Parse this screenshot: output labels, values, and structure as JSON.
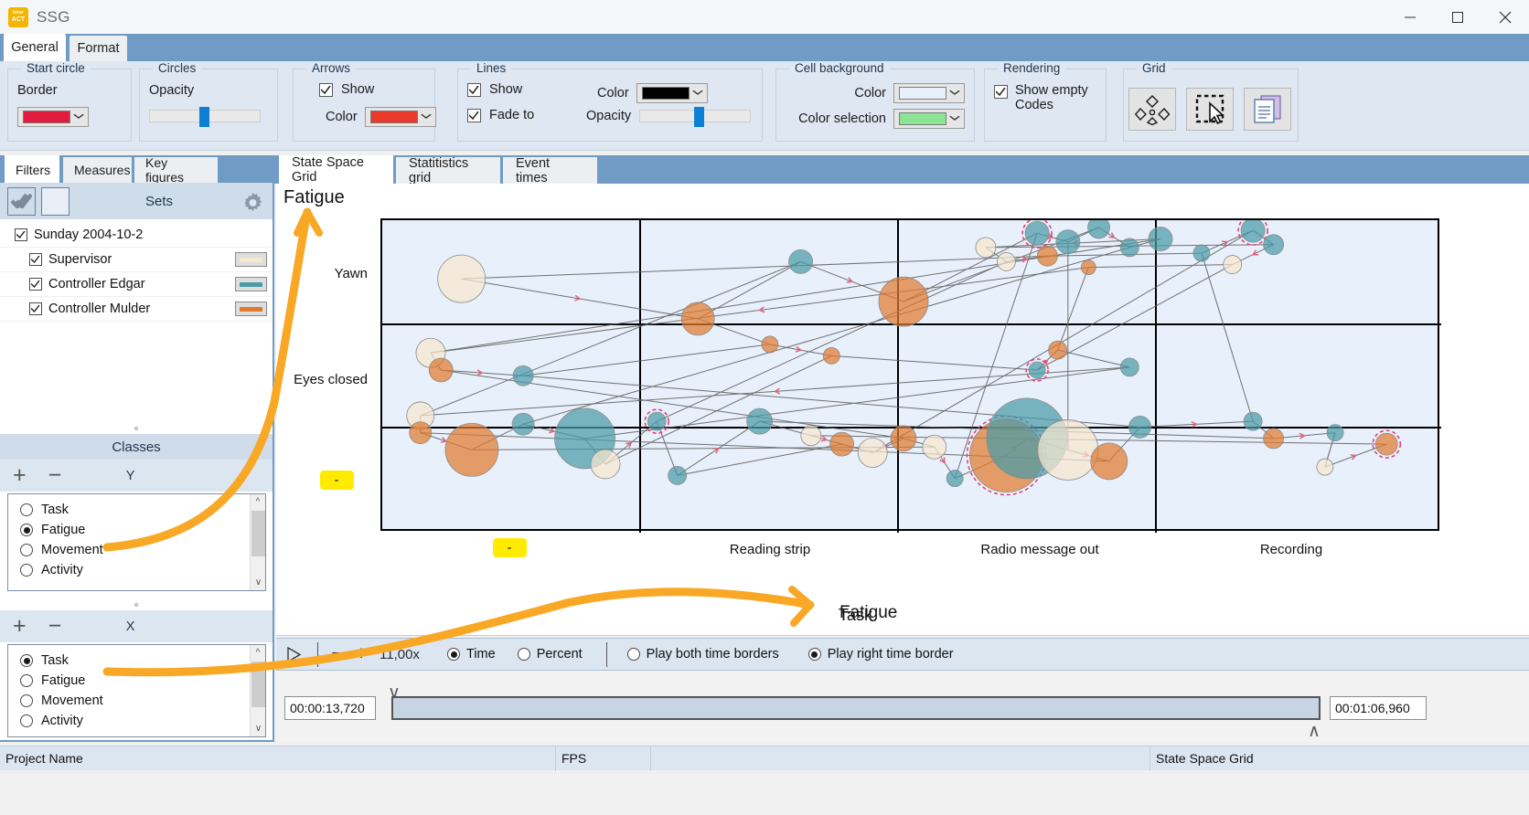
{
  "window": {
    "title": "SSG",
    "logo_text": "inter ACT",
    "minimize_label": "Minimize",
    "maximize_label": "Maximize",
    "close_label": "Close"
  },
  "ribbon": {
    "tabs": [
      {
        "label": "General",
        "active": true
      },
      {
        "label": "Format",
        "active": false
      }
    ],
    "groups": {
      "start_circle": {
        "title": "Start circle",
        "border_label": "Border",
        "border_color": "#e01b3c"
      },
      "circles": {
        "title": "Circles",
        "opacity_label": "Opacity",
        "opacity_value": 48
      },
      "arrows": {
        "title": "Arrows",
        "show_label": "Show",
        "show_checked": true,
        "color_label": "Color",
        "color_value": "#e8392b"
      },
      "lines": {
        "title": "Lines",
        "show_label": "Show",
        "show_checked": true,
        "fade_label": "Fade to",
        "fade_checked": true,
        "color_label": "Color",
        "color_value": "#000000",
        "opacity_label": "Opacity",
        "opacity_value": 52
      },
      "cell_background": {
        "title": "Cell background",
        "color_label": "Color",
        "color_value": "#e8f0fb",
        "selection_label": "Color selection",
        "selection_value": "#8ce496"
      },
      "rendering": {
        "title": "Rendering",
        "show_empty_label": "Show empty",
        "codes_label": "Codes",
        "show_empty_checked": true
      },
      "grid": {
        "title": "Grid",
        "buttons": [
          {
            "name": "grid-diamonds-icon",
            "label": "Grid diamonds"
          },
          {
            "name": "grid-select-icon",
            "label": "Grid select"
          },
          {
            "name": "grid-copy-icon",
            "label": "Grid copy"
          }
        ]
      }
    }
  },
  "left_panel": {
    "tabs": [
      {
        "label": "Filters",
        "active": true
      },
      {
        "label": "Measures",
        "active": false
      },
      {
        "label": "Key figures",
        "active": false
      }
    ],
    "sets": {
      "title": "Sets",
      "check_all_label": "Check all",
      "uncheck_all_label": "Uncheck all",
      "gear_label": "Settings",
      "rows": [
        {
          "label": "Sunday 2004-10-2",
          "checked": true,
          "indent": 0,
          "swatch": null
        },
        {
          "label": "Supervisor",
          "checked": true,
          "indent": 1,
          "swatch": "#f7e8d0"
        },
        {
          "label": "Controller Edgar",
          "checked": true,
          "indent": 1,
          "swatch": "#4a9ba8"
        },
        {
          "label": "Controller Mulder",
          "checked": true,
          "indent": 1,
          "swatch": "#e07a2f"
        }
      ]
    },
    "classes": {
      "title": "Classes",
      "y_axis": {
        "name": "Y",
        "add_label": "+",
        "remove_label": "−",
        "options": [
          {
            "label": "Task",
            "selected": false
          },
          {
            "label": "Fatigue",
            "selected": true
          },
          {
            "label": "Movement",
            "selected": false
          },
          {
            "label": "Activity",
            "selected": false
          }
        ]
      },
      "x_axis": {
        "name": "X",
        "add_label": "+",
        "remove_label": "−",
        "options": [
          {
            "label": "Task",
            "selected": true
          },
          {
            "label": "Fatigue",
            "selected": false
          },
          {
            "label": "Movement",
            "selected": false
          },
          {
            "label": "Activity",
            "selected": false
          }
        ]
      }
    }
  },
  "main": {
    "tabs": [
      {
        "label": "State Space Grid",
        "active": true
      },
      {
        "label": "Statitistics grid",
        "active": false
      },
      {
        "label": "Event times",
        "active": false
      }
    ]
  },
  "chart_data": {
    "type": "scatter",
    "title": "Fatigue",
    "ylabel": "Fatigue",
    "xlabel": "Task",
    "y_categories": [
      "Yawn",
      "Eyes closed",
      "-"
    ],
    "x_categories": [
      "-",
      "Reading strip",
      "Radio message out",
      "Recording"
    ],
    "grid": true,
    "legend": "none",
    "annotation_y_label": "Fatigue",
    "annotation_x_label": "Task",
    "highlight_y_category": "-",
    "highlight_x_category": "-",
    "series": [
      {
        "name": "Supervisor",
        "color": "#f7e8d0",
        "values": []
      },
      {
        "name": "Controller Edgar",
        "color": "#4a9ba8",
        "values": []
      },
      {
        "name": "Controller Mulder",
        "color": "#e07a2f",
        "values": []
      }
    ],
    "nodes": [
      {
        "s": 0,
        "x": 0.07,
        "y": 0.18,
        "r": 26
      },
      {
        "s": 2,
        "x": 0.3,
        "y": 0.32,
        "r": 18
      },
      {
        "s": 1,
        "x": 0.4,
        "y": 0.12,
        "r": 13
      },
      {
        "s": 2,
        "x": 0.5,
        "y": 0.26,
        "r": 27
      },
      {
        "s": 1,
        "x": 0.63,
        "y": 0.02,
        "r": 13
      },
      {
        "s": 1,
        "x": 0.66,
        "y": 0.05,
        "r": 13
      },
      {
        "s": 1,
        "x": 0.69,
        "y": 0.0,
        "r": 12
      },
      {
        "s": 1,
        "x": 0.72,
        "y": 0.07,
        "r": 10
      },
      {
        "s": 1,
        "x": 0.75,
        "y": 0.04,
        "r": 13
      },
      {
        "s": 0,
        "x": 0.58,
        "y": 0.07,
        "r": 11
      },
      {
        "s": 0,
        "x": 0.6,
        "y": 0.12,
        "r": 10
      },
      {
        "s": 2,
        "x": 0.64,
        "y": 0.1,
        "r": 11
      },
      {
        "s": 1,
        "x": 0.79,
        "y": 0.09,
        "r": 9
      },
      {
        "s": 1,
        "x": 0.84,
        "y": 0.01,
        "r": 13
      },
      {
        "s": 1,
        "x": 0.86,
        "y": 0.06,
        "r": 11
      },
      {
        "s": 0,
        "x": 0.82,
        "y": 0.13,
        "r": 10
      },
      {
        "s": 2,
        "x": 0.68,
        "y": 0.14,
        "r": 8
      },
      {
        "s": 0,
        "x": 0.04,
        "y": 0.44,
        "r": 16
      },
      {
        "s": 2,
        "x": 0.05,
        "y": 0.5,
        "r": 13
      },
      {
        "s": 1,
        "x": 0.13,
        "y": 0.52,
        "r": 11
      },
      {
        "s": 2,
        "x": 0.37,
        "y": 0.41,
        "r": 9
      },
      {
        "s": 2,
        "x": 0.43,
        "y": 0.45,
        "r": 9
      },
      {
        "s": 1,
        "x": 0.63,
        "y": 0.5,
        "r": 9
      },
      {
        "s": 2,
        "x": 0.65,
        "y": 0.43,
        "r": 10
      },
      {
        "s": 1,
        "x": 0.72,
        "y": 0.49,
        "r": 10
      },
      {
        "s": 0,
        "x": 0.03,
        "y": 0.66,
        "r": 15
      },
      {
        "s": 2,
        "x": 0.03,
        "y": 0.72,
        "r": 12
      },
      {
        "s": 2,
        "x": 0.08,
        "y": 0.78,
        "r": 29
      },
      {
        "s": 1,
        "x": 0.13,
        "y": 0.69,
        "r": 12
      },
      {
        "s": 1,
        "x": 0.19,
        "y": 0.74,
        "r": 33
      },
      {
        "s": 0,
        "x": 0.21,
        "y": 0.83,
        "r": 16
      },
      {
        "s": 1,
        "x": 0.26,
        "y": 0.68,
        "r": 10
      },
      {
        "s": 1,
        "x": 0.28,
        "y": 0.87,
        "r": 10
      },
      {
        "s": 1,
        "x": 0.36,
        "y": 0.68,
        "r": 14
      },
      {
        "s": 0,
        "x": 0.41,
        "y": 0.73,
        "r": 11
      },
      {
        "s": 2,
        "x": 0.44,
        "y": 0.76,
        "r": 13
      },
      {
        "s": 0,
        "x": 0.47,
        "y": 0.79,
        "r": 16
      },
      {
        "s": 2,
        "x": 0.5,
        "y": 0.74,
        "r": 14
      },
      {
        "s": 0,
        "x": 0.53,
        "y": 0.77,
        "r": 13
      },
      {
        "s": 1,
        "x": 0.55,
        "y": 0.88,
        "r": 9
      },
      {
        "s": 2,
        "x": 0.6,
        "y": 0.8,
        "r": 40
      },
      {
        "s": 1,
        "x": 0.62,
        "y": 0.74,
        "r": 44
      },
      {
        "s": 0,
        "x": 0.66,
        "y": 0.78,
        "r": 33
      },
      {
        "s": 2,
        "x": 0.7,
        "y": 0.82,
        "r": 20
      },
      {
        "s": 1,
        "x": 0.73,
        "y": 0.7,
        "r": 12
      },
      {
        "s": 1,
        "x": 0.84,
        "y": 0.68,
        "r": 10
      },
      {
        "s": 2,
        "x": 0.86,
        "y": 0.74,
        "r": 11
      },
      {
        "s": 1,
        "x": 0.92,
        "y": 0.72,
        "r": 9
      },
      {
        "s": 0,
        "x": 0.91,
        "y": 0.84,
        "r": 9
      },
      {
        "s": 2,
        "x": 0.97,
        "y": 0.76,
        "r": 12
      }
    ]
  },
  "playback": {
    "play_label": "Play",
    "minus_label": "−",
    "plus_label": "+",
    "speed": "11,00x",
    "mode_options": [
      {
        "label": "Time",
        "selected": true
      },
      {
        "label": "Percent",
        "selected": false
      }
    ],
    "border_options": [
      {
        "label": "Play both time borders",
        "selected": false
      },
      {
        "label": "Play right time border",
        "selected": true
      }
    ],
    "time_start": "00:00:13,720",
    "time_end": "00:01:06,960",
    "collapse_down_label": "Collapse",
    "collapse_up_label": "Expand"
  },
  "statusbar": {
    "cells": [
      "Project Name",
      "FPS",
      "",
      "State Space Grid"
    ]
  }
}
